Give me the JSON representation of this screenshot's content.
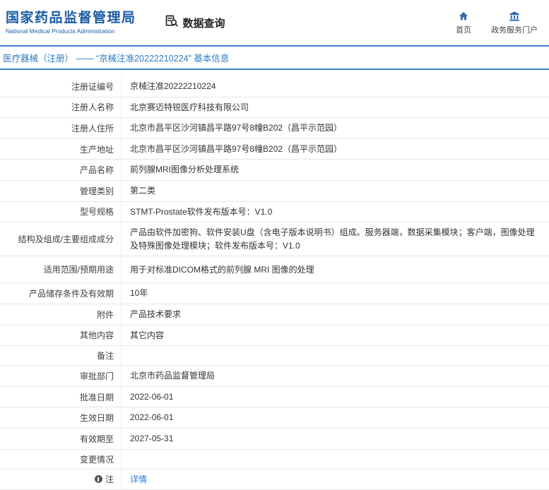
{
  "colors": {
    "brand_blue": "#1b5aa6",
    "line_blue": "#3f7fbe",
    "breadcrumb_blue": "#2b7bbf",
    "link_blue": "#2a7ae2"
  },
  "header": {
    "logo_title": "国家药品监督管理局",
    "logo_subtitle": "National Medical Products Administration",
    "section_title": "数据查询",
    "section_icon": "search-doc-icon",
    "nav": [
      {
        "label": "首页",
        "icon": "home-icon"
      },
      {
        "label": "政务服务门户",
        "icon": "gov-portal-icon"
      }
    ]
  },
  "breadcrumb": {
    "text": "医疗器械（注册） —— “京械注准20222210224” 基本信息"
  },
  "table": {
    "rows": [
      {
        "label": "注册证编号",
        "value": "京械注准20222210224"
      },
      {
        "label": "注册人名称",
        "value": "北京赛迈特锐医疗科技有限公司"
      },
      {
        "label": "注册人住所",
        "value": "北京市昌平区沙河镇昌平路97号8幢B202（昌平示范园）"
      },
      {
        "label": "生产地址",
        "value": "北京市昌平区沙河镇昌平路97号8幢B202（昌平示范园）"
      },
      {
        "label": "产品名称",
        "value": "前列腺MRI图像分析处理系统"
      },
      {
        "label": "管理类别",
        "value": "第二类"
      },
      {
        "label": "型号规格",
        "value": "STMT-Prostate软件发布版本号：V1.0"
      },
      {
        "label": "结构及组成/主要组成成分",
        "value": "产品由软件加密狗、软件安装U盘（含电子版本说明书）组成。服务器端，数据采集模块；客户端，图像处理及特殊图像处理模块；软件发布版本号：V1.0"
      },
      {
        "label": "适用范围/预期用途",
        "value": "用于对标准DICOM格式的前列腺 MRI 图像的处理"
      },
      {
        "label": "产品储存条件及有效期",
        "value": "10年"
      },
      {
        "label": "附件",
        "value": "产品技术要求"
      },
      {
        "label": "其他内容",
        "value": "其它内容"
      },
      {
        "label": "备注",
        "value": ""
      },
      {
        "label": "审批部门",
        "value": "北京市药品监督管理局"
      },
      {
        "label": "批准日期",
        "value": "2022-06-01"
      },
      {
        "label": "生效日期",
        "value": "2022-06-01"
      },
      {
        "label": "有效期至",
        "value": "2027-05-31"
      },
      {
        "label": "变更情况",
        "value": ""
      },
      {
        "label": "注",
        "value": "详情",
        "note_icon": "note-icon"
      }
    ]
  }
}
